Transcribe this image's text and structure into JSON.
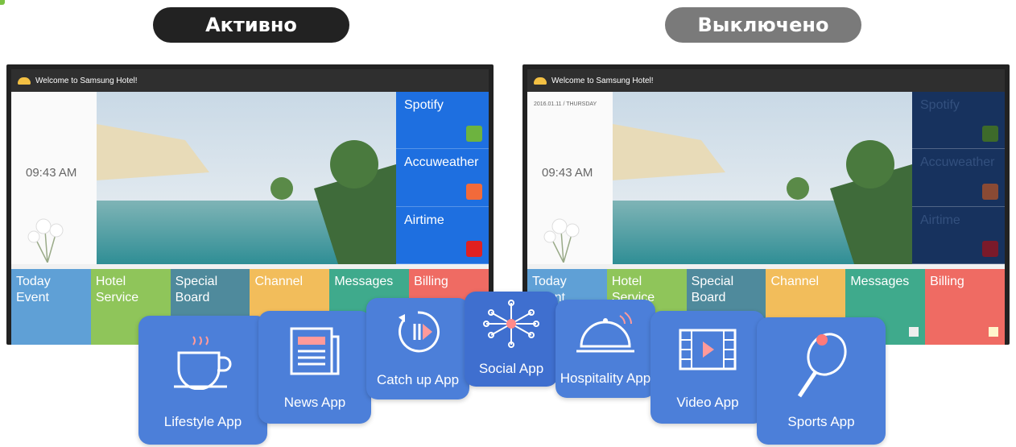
{
  "status_pills": {
    "active": "Активно",
    "inactive": "Выключено"
  },
  "screens": {
    "welcome": "Welcome to Samsung Hotel!",
    "date": "2016.01.11 / THURSDAY",
    "time": "09:43 AM",
    "side_apps": [
      "Spotify",
      "Accuweather",
      "Airtime"
    ],
    "tiles": [
      {
        "label": "Today Event",
        "color": "#5fa0d6"
      },
      {
        "label": "Hotel Service",
        "color": "#8fc55a"
      },
      {
        "label": "Special Board",
        "color": "#4f8a9c"
      },
      {
        "label": "Channel",
        "color": "#f2bd5b"
      },
      {
        "label": "Messages",
        "color": "#3faa8c"
      },
      {
        "label": "Billing",
        "color": "#ef6b63"
      }
    ]
  },
  "app_icons": [
    {
      "name": "lifestyle",
      "label": "Lifestyle App",
      "icon": "coffee-cup-icon"
    },
    {
      "name": "news",
      "label": "News App",
      "icon": "newspaper-icon"
    },
    {
      "name": "catchup",
      "label": "Catch up App",
      "icon": "replay-icon"
    },
    {
      "name": "social",
      "label": "Social App",
      "icon": "network-icon"
    },
    {
      "name": "hospitality",
      "label": "Hospitality App",
      "icon": "bell-icon"
    },
    {
      "name": "video",
      "label": "Video App",
      "icon": "film-icon"
    },
    {
      "name": "sports",
      "label": "Sports App",
      "icon": "racket-icon"
    }
  ]
}
